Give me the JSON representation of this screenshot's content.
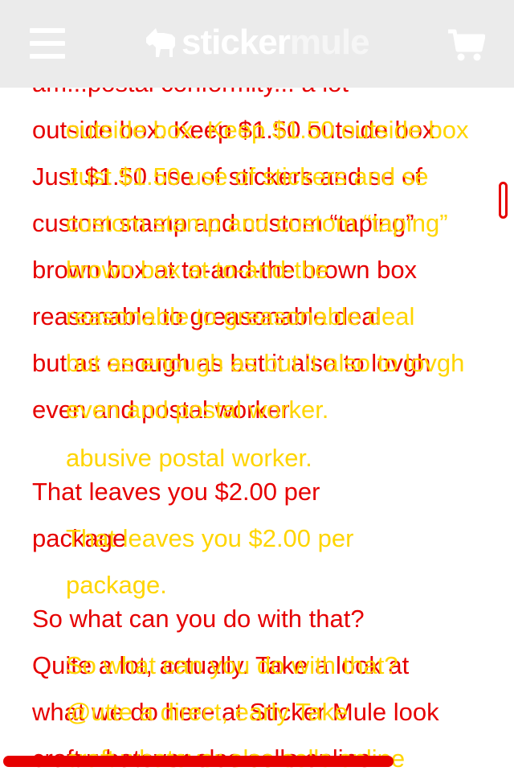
{
  "header": {
    "logo_part1": "sticker",
    "logo_part2": "mule"
  },
  "article": {
    "lines_a": [
      "am...postal conformity... a lot",
      "outside box. Keep $1.50 outside box",
      "Just $1.50 use of stickers and se of",
      "custom stamp and custom “taping”",
      "brown box at to-and-the brown box",
      "reasonable to greasonable deal",
      "but as enough as but it also to lovgh",
      "even and postal worker.",
      "",
      "That leaves you $2.00 per",
      "package",
      "",
      "So what can you do with that?",
      "Quite a lot, actually. Take a look at",
      "what we do here at Sticker Mule look",
      "craft whatever else sells online"
    ],
    "lines_b": [
      "",
      "outside box. Keep $1.50 outside box",
      "Just $1.50 use of stickers and se",
      "custom stamp and custom “taping”",
      "brown box at to-and-the",
      "reasonable to greasonable deal",
      "but as enough as but it also to lovgh",
      "even and postal worker.",
      "abusive postal worker.",
      "",
      "That leaves you $2.00 per",
      "package.",
      "",
      "So what can you do with that?",
      "@utte a direct, early Take",
      "craft whatever else sells online"
    ]
  },
  "colors": {
    "header_bg": "#ebebeb",
    "text_primary": "#e60000",
    "text_secondary": "#ffd500"
  }
}
